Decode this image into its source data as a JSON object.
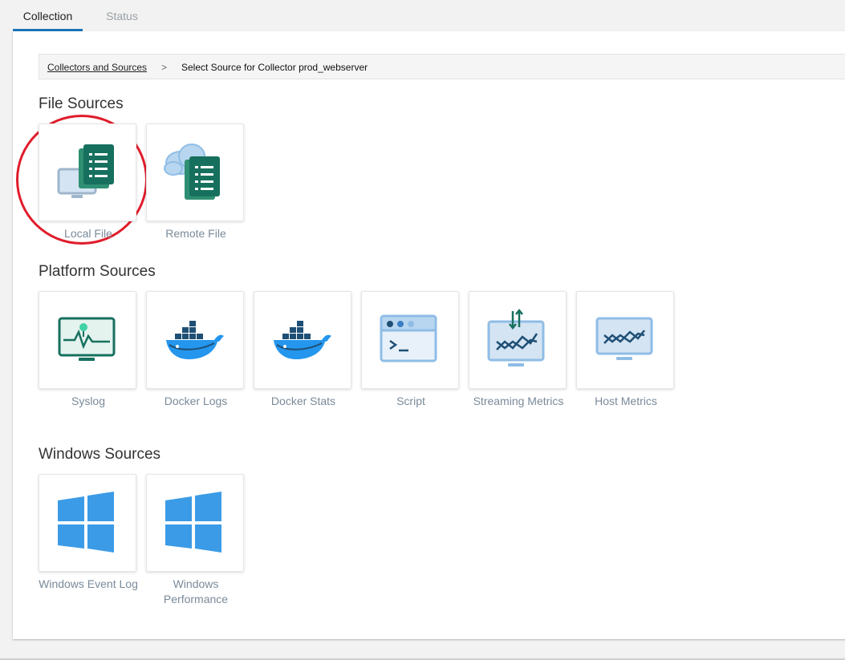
{
  "tabs": [
    {
      "label": "Collection",
      "active": true
    },
    {
      "label": "Status",
      "active": false
    }
  ],
  "breadcrumb": {
    "link": "Collectors and Sources",
    "separator": ">",
    "current": "Select Source for Collector prod_webserver"
  },
  "sections": {
    "file": {
      "title": "File Sources",
      "items": [
        {
          "label": "Local File",
          "icon": "local-file-icon",
          "highlighted": true
        },
        {
          "label": "Remote File",
          "icon": "remote-file-icon"
        }
      ]
    },
    "platform": {
      "title": "Platform Sources",
      "items": [
        {
          "label": "Syslog",
          "icon": "syslog-icon"
        },
        {
          "label": "Docker Logs",
          "icon": "docker-logs-icon"
        },
        {
          "label": "Docker Stats",
          "icon": "docker-stats-icon"
        },
        {
          "label": "Script",
          "icon": "script-icon"
        },
        {
          "label": "Streaming Metrics",
          "icon": "streaming-metrics-icon"
        },
        {
          "label": "Host Metrics",
          "icon": "host-metrics-icon"
        }
      ]
    },
    "windows": {
      "title": "Windows Sources",
      "items": [
        {
          "label": "Windows Event Log",
          "icon": "windows-event-log-icon"
        },
        {
          "label": "Windows Performance",
          "icon": "windows-performance-icon"
        }
      ]
    }
  },
  "colors": {
    "accent_tab": "#1b75bb",
    "file_green": "#17705e",
    "monitor_light": "#d4e4f3",
    "windows_blue": "#3b9be6",
    "highlight_red": "#e01c2b"
  }
}
